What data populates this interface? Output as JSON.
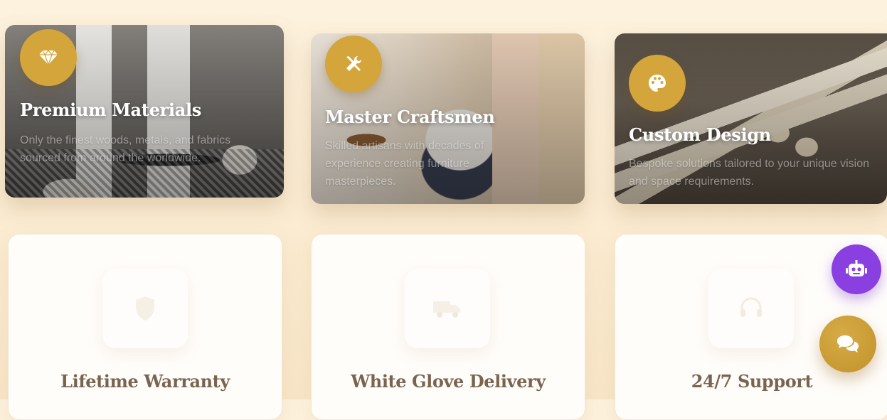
{
  "cards": [
    {
      "title": "Premium Materials",
      "description": "Only the finest woods, metals, and fabrics sourced from around the worldwide.",
      "icon": "diamond-icon"
    },
    {
      "title": "Master Craftsmen",
      "description": "Skilled artisans with decades of experience creating furniture masterpieces.",
      "icon": "tools-icon"
    },
    {
      "title": "Custom Design",
      "description": "Bespoke solutions tailored to your unique vision and space requirements.",
      "icon": "palette-icon"
    }
  ],
  "features": [
    {
      "title": "Lifetime Warranty",
      "icon": "shield-icon"
    },
    {
      "title": "White Glove Delivery",
      "icon": "truck-icon"
    },
    {
      "title": "24/7 Support",
      "icon": "headset-icon"
    }
  ],
  "fabs": {
    "bot": {
      "icon": "robot-icon",
      "color": "#8a3fe0"
    },
    "chat": {
      "icon": "chat-icon",
      "color": "#c99a32"
    }
  },
  "colors": {
    "accent": "#d4a53a",
    "heading": "#7a6450"
  }
}
